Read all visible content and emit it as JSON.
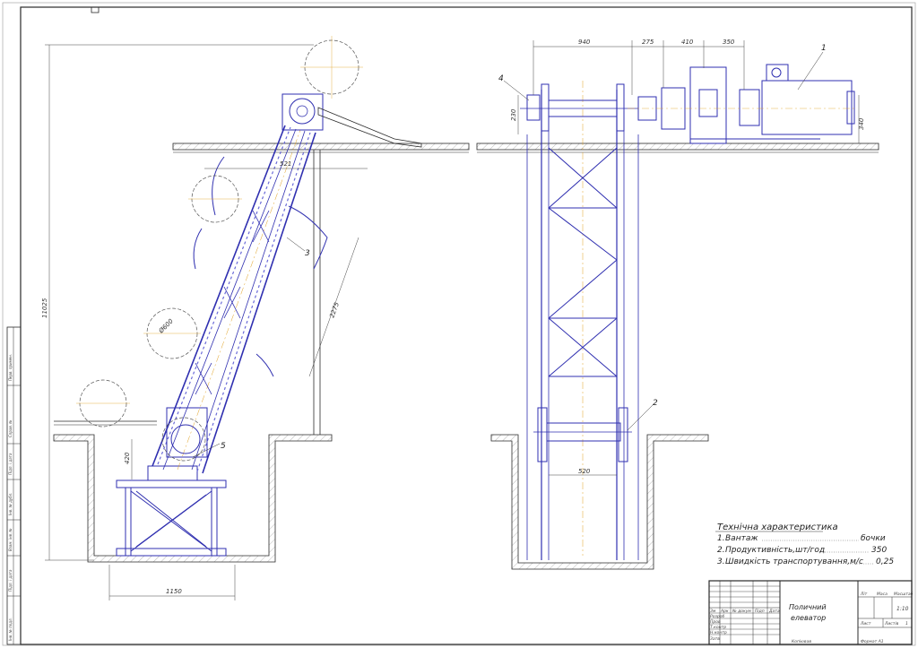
{
  "colors": {
    "frame": "#2a2a2a",
    "structure": "#2f2fb0",
    "structure_light": "#6a6ad8",
    "center_line": "#e0a020",
    "dimension": "#444444",
    "hatch": "#777777"
  },
  "left_view": {
    "dimensions": {
      "total_height": "11025",
      "top_width": "521",
      "incline_length": "2275",
      "pit_depth": "420",
      "base_width": "1150",
      "barrel_diameter": "Ø600"
    },
    "callouts": {
      "c3": "3",
      "c5": "5"
    }
  },
  "right_view": {
    "dimensions": {
      "d940": "940",
      "d275": "275",
      "d410": "410",
      "d350": "350",
      "d230": "230",
      "d340": "340",
      "d520": "520"
    },
    "callouts": {
      "c1": "1",
      "c2": "2",
      "c4": "4"
    }
  },
  "spec": {
    "title": "Технічна характеристика",
    "lines": [
      {
        "num": "1.",
        "label": "Вантаж",
        "value": "бочки"
      },
      {
        "num": "2.",
        "label": "Продуктивність,шт/год",
        "value": "350"
      },
      {
        "num": "3.",
        "label": "Швидкість транспортування,м/с",
        "value": "0,25"
      }
    ]
  },
  "title_block": {
    "name_line1": "Поличний",
    "name_line2": "елеватор",
    "col_lit": "Літ",
    "col_mass": "Маса",
    "col_scale": "Масштаб",
    "scale": "1:10",
    "sheet": "Лист",
    "sheets": "Листів",
    "sheets_count": "1",
    "rows": [
      "Зм",
      "Арк",
      "№ докум",
      "Підп",
      "Дата"
    ],
    "roles": [
      "Розроб",
      "Пров",
      "Т.контр",
      "Н.контр",
      "Затв"
    ],
    "copied": "Копіював",
    "format": "Формат   А1"
  },
  "side_stamp": [
    "Перв. примен.",
    "Справ. №",
    "Підп. і дата",
    "Інв. № дубл.",
    "Взам. інв. №",
    "Підп. і дата",
    "Інв. № подл."
  ]
}
